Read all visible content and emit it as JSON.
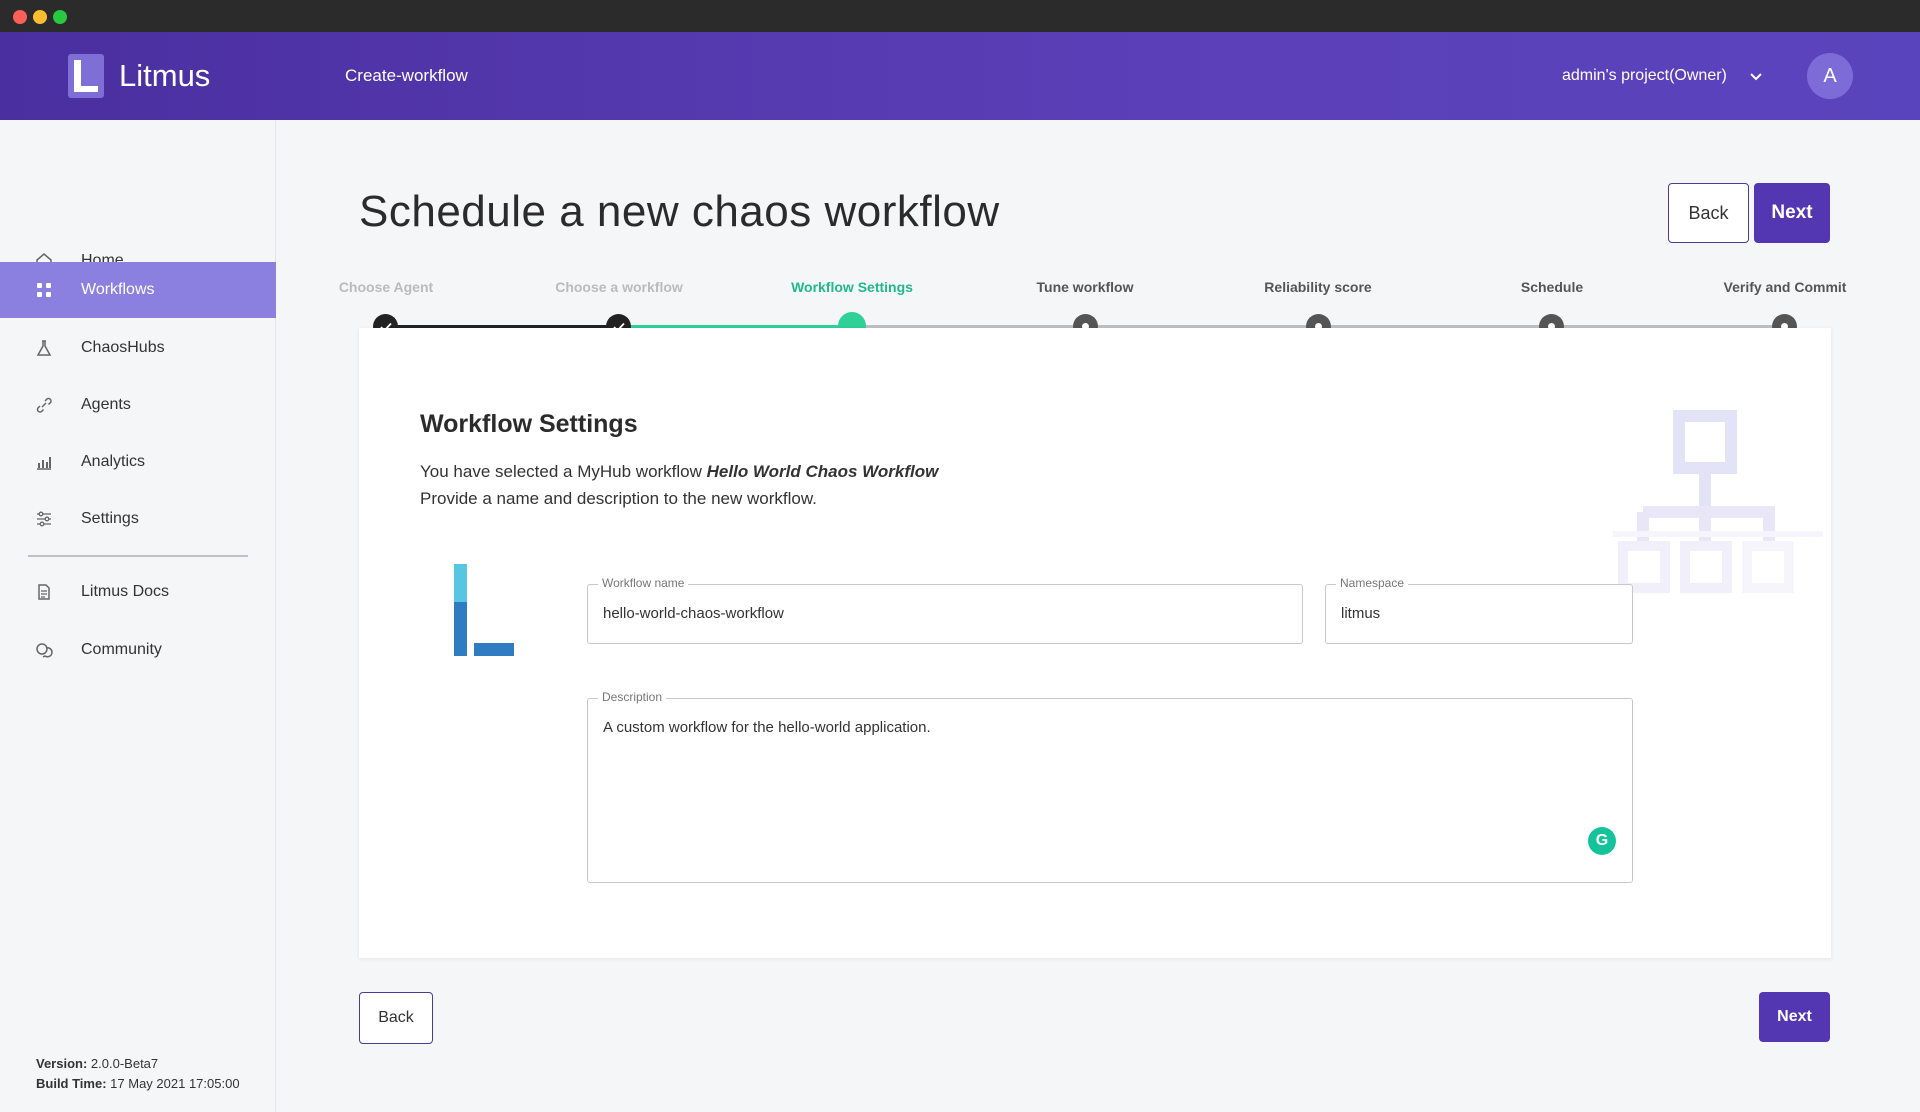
{
  "header": {
    "brand": "Litmus",
    "page": "Create-workflow",
    "project": "admin's project(Owner)",
    "avatar_initial": "A"
  },
  "sidebar": {
    "items": [
      {
        "label": "Home",
        "icon": "home-icon"
      },
      {
        "label": "Workflows",
        "icon": "workflows-icon",
        "active": true
      },
      {
        "label": "ChaosHubs",
        "icon": "flask-icon"
      },
      {
        "label": "Agents",
        "icon": "link-icon"
      },
      {
        "label": "Analytics",
        "icon": "analytics-icon"
      },
      {
        "label": "Settings",
        "icon": "settings-icon"
      }
    ],
    "bottom_items": [
      {
        "label": "Litmus Docs",
        "icon": "document-icon"
      },
      {
        "label": "Community",
        "icon": "chat-icon"
      }
    ],
    "version_label": "Version:",
    "version_value": "2.0.0-Beta7",
    "build_label": "Build Time:",
    "build_value": "17 May 2021 17:05:00"
  },
  "main": {
    "title": "Schedule a new chaos workflow",
    "back_label": "Back",
    "next_label": "Next"
  },
  "stepper": {
    "steps": [
      {
        "label": "Choose Agent",
        "state": "done"
      },
      {
        "label": "Choose a workflow",
        "state": "done"
      },
      {
        "label": "Workflow Settings",
        "state": "current"
      },
      {
        "label": "Tune workflow",
        "state": "future"
      },
      {
        "label": "Reliability score",
        "state": "future"
      },
      {
        "label": "Schedule",
        "state": "future"
      },
      {
        "label": "Verify and Commit",
        "state": "future"
      }
    ]
  },
  "card": {
    "title": "Workflow Settings",
    "desc_prefix": "You have selected a MyHub workflow ",
    "desc_workflow": "Hello World Chaos Workflow",
    "desc_line2": "Provide a name and description to the new workflow.",
    "workflow_name_label": "Workflow name",
    "workflow_name_value": "hello-world-chaos-workflow",
    "namespace_label": "Namespace",
    "namespace_value": "litmus",
    "description_label": "Description",
    "description_value": "A custom workflow for the hello-world application.",
    "grammarly_glyph": "G"
  },
  "colors": {
    "header": "#5337b2",
    "active_nav": "#8b7fe0",
    "step_current": "#2ed198",
    "primary_button": "#5337b2"
  }
}
